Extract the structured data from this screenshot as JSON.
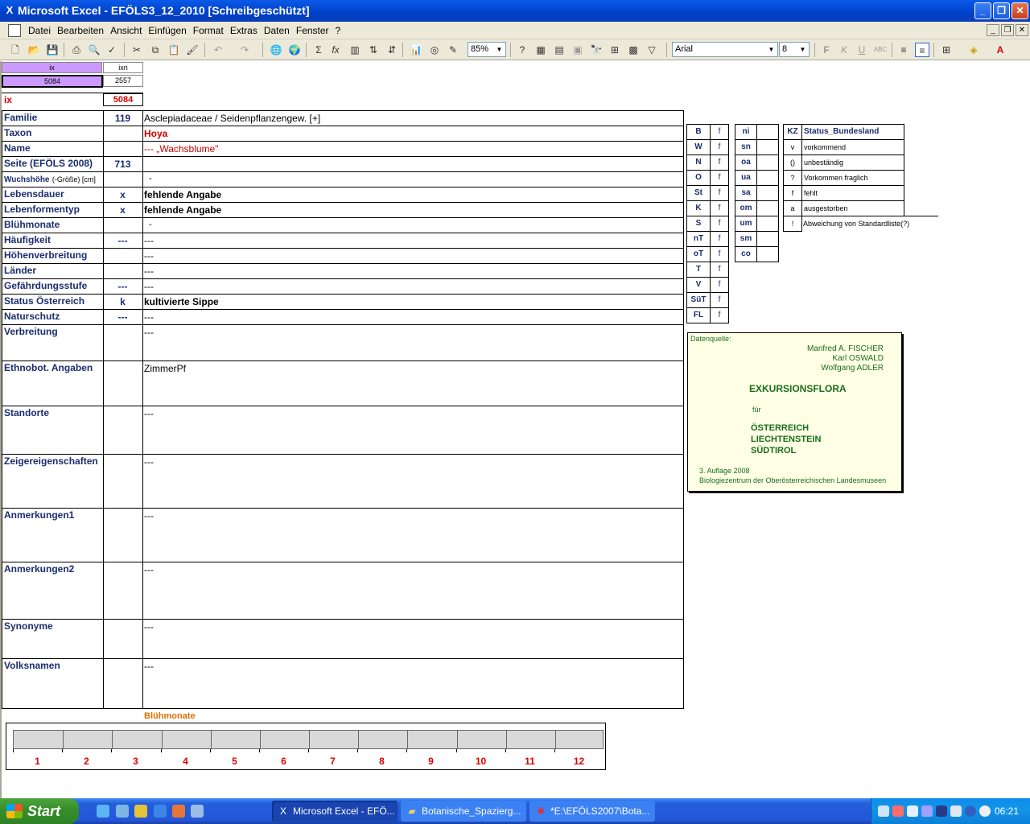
{
  "window": {
    "title": "Microsoft Excel - EFÖLS3_12_2010  [Schreibgeschützt]",
    "minimize": "_",
    "restore": "❐",
    "close": "✕"
  },
  "menubar": {
    "items": [
      "Datei",
      "Bearbeiten",
      "Ansicht",
      "Einfügen",
      "Format",
      "Extras",
      "Daten",
      "Fenster",
      "?"
    ]
  },
  "toolbar": {
    "zoom": "85%",
    "font_name": "Arial",
    "font_size": "8"
  },
  "index_block": {
    "ix_header": "ix",
    "ixn_header": "ixn",
    "ix_value": "5084",
    "ixn_value": "2557",
    "ix_label": "ix",
    "ix_label_value": "5084"
  },
  "rows": [
    {
      "label": "Familie",
      "code": "119",
      "value": "Asclepiadaceae  /  Seidenpflanzengew. [+]"
    },
    {
      "label": "Taxon",
      "code": "",
      "value": "Hoya"
    },
    {
      "label": "Name",
      "code": "",
      "value": "--- „Wachsblume\""
    },
    {
      "label": "Seite (EFÖLS 2008)",
      "code": "713",
      "value": ""
    },
    {
      "label": "Wuchshöhe",
      "label_suffix": "(-Größe) [cm]",
      "code": "",
      "value": "-"
    },
    {
      "label": "Lebensdauer",
      "code": "x",
      "value": "fehlende Angabe"
    },
    {
      "label": "Lebenformentyp",
      "code": "x",
      "value": "fehlende Angabe"
    },
    {
      "label": "Blühmonate",
      "code": "",
      "value": "-"
    },
    {
      "label": "Häufigkeit",
      "code": "---",
      "value": "---"
    },
    {
      "label": "Höhenverbreitung",
      "code": "",
      "value": "---"
    },
    {
      "label": "Länder",
      "code": "",
      "value": "---"
    },
    {
      "label": "Gefährdungsstufe",
      "code": "---",
      "value": "---"
    },
    {
      "label": "Status Österreich",
      "code": "k",
      "value": "kultivierte Sippe"
    },
    {
      "label": "Naturschutz",
      "code": "---",
      "value": "---"
    },
    {
      "label": "Verbreitung",
      "code": "",
      "value": "---"
    },
    {
      "label": "Ethnobot. Angaben",
      "code": "",
      "value": "ZimmerPf"
    },
    {
      "label": "Standorte",
      "code": "",
      "value": "---"
    },
    {
      "label": "Zeigereigenschaften",
      "code": "",
      "value": "---"
    },
    {
      "label": "Anmerkungen1",
      "code": "",
      "value": "---"
    },
    {
      "label": "Anmerkungen2",
      "code": "",
      "value": "---"
    },
    {
      "label": "Synonyme",
      "code": "",
      "value": "---"
    },
    {
      "label": "Volksnamen",
      "code": "",
      "value": "---"
    }
  ],
  "region_table1": [
    {
      "k": "B",
      "v": "f"
    },
    {
      "k": "W",
      "v": "f"
    },
    {
      "k": "N",
      "v": "f"
    },
    {
      "k": "O",
      "v": "f"
    },
    {
      "k": "St",
      "v": "f"
    },
    {
      "k": "K",
      "v": "f"
    },
    {
      "k": "S",
      "v": "f"
    },
    {
      "k": "nT",
      "v": "f"
    },
    {
      "k": "oT",
      "v": "f"
    },
    {
      "k": "T",
      "v": "f"
    },
    {
      "k": "V",
      "v": "f"
    },
    {
      "k": "SüT",
      "v": "f"
    },
    {
      "k": "FL",
      "v": "f"
    }
  ],
  "region_table2": [
    {
      "k": "ni",
      "v": ""
    },
    {
      "k": "sn",
      "v": ""
    },
    {
      "k": "oa",
      "v": ""
    },
    {
      "k": "ua",
      "v": ""
    },
    {
      "k": "sa",
      "v": ""
    },
    {
      "k": "om",
      "v": ""
    },
    {
      "k": "um",
      "v": ""
    },
    {
      "k": "sm",
      "v": ""
    },
    {
      "k": "co",
      "v": ""
    }
  ],
  "status_legend": {
    "header_kz": "KZ",
    "header_label": "Status_Bundesland",
    "items": [
      {
        "k": "v",
        "v": "vorkommend"
      },
      {
        "k": "()",
        "v": "unbeständig"
      },
      {
        "k": "?",
        "v": "Vorkommen fraglich"
      },
      {
        "k": "f",
        "v": "fehlt"
      },
      {
        "k": "a",
        "v": "ausgestorben"
      },
      {
        "k": "!",
        "v": "Abweichung von Standardliste(?)"
      }
    ]
  },
  "source_box": {
    "label": "Datenquelle:",
    "authors": [
      "Manfred A. FISCHER",
      "Karl OSWALD",
      "Wolfgang ADLER"
    ],
    "title": "EXKURSIONSFLORA",
    "for": "für",
    "countries": [
      "ÖSTERREICH",
      "LIECHTENSTEIN",
      "SÜDTIROL"
    ],
    "edition": "3. Auflage 2008",
    "publisher": "Biologiezentrum der Oberösterreichischen Landesmuseen"
  },
  "months_chart": {
    "title": "Blühmonate",
    "months": [
      "1",
      "2",
      "3",
      "4",
      "5",
      "6",
      "7",
      "8",
      "9",
      "10",
      "11",
      "12"
    ]
  },
  "taskbar": {
    "start": "Start",
    "tasks": [
      "Microsoft Excel - EFÖ...",
      "Botanische_Spazierg...",
      "*E:\\EFÖLS2007\\Bota..."
    ],
    "clock": "06:21"
  }
}
